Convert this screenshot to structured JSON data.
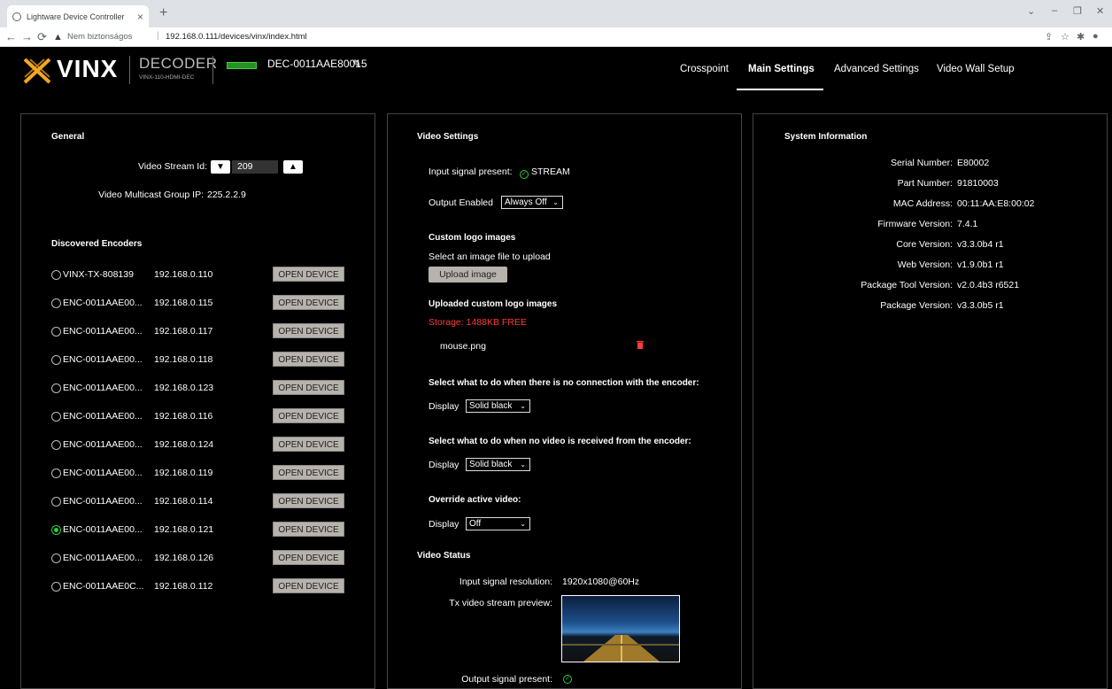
{
  "browser": {
    "tab_title": "Lightware Device Controller",
    "security_label": "Nem biztonságos",
    "url": "192.168.0.111/devices/vinx/index.html"
  },
  "header": {
    "logo": "VINX",
    "product_type": "DECODER",
    "product_model": "VINX-110-HDMI-DEC",
    "badge": "MULTICAST",
    "device_name": "DEC-0011AAE80015",
    "nav": [
      "Crosspoint",
      "Main Settings",
      "Advanced Settings",
      "Video Wall Setup"
    ],
    "active_nav": "Main Settings"
  },
  "general": {
    "title": "General",
    "stream_id_label": "Video Stream Id:",
    "stream_id": "209",
    "multicast_label": "Video Multicast Group IP:",
    "multicast_ip": "225.2.2.9",
    "encoders_title": "Discovered Encoders",
    "open_label": "OPEN DEVICE",
    "encoders": [
      {
        "name": "VINX-TX-808139",
        "ip": "192.168.0.110",
        "selected": false
      },
      {
        "name": "ENC-0011AAE00...",
        "ip": "192.168.0.115",
        "selected": false
      },
      {
        "name": "ENC-0011AAE00...",
        "ip": "192.168.0.117",
        "selected": false
      },
      {
        "name": "ENC-0011AAE00...",
        "ip": "192.168.0.118",
        "selected": false
      },
      {
        "name": "ENC-0011AAE00...",
        "ip": "192.168.0.123",
        "selected": false
      },
      {
        "name": "ENC-0011AAE00...",
        "ip": "192.168.0.116",
        "selected": false
      },
      {
        "name": "ENC-0011AAE00...",
        "ip": "192.168.0.124",
        "selected": false
      },
      {
        "name": "ENC-0011AAE00...",
        "ip": "192.168.0.119",
        "selected": false
      },
      {
        "name": "ENC-0011AAE00...",
        "ip": "192.168.0.114",
        "selected": false
      },
      {
        "name": "ENC-0011AAE00...",
        "ip": "192.168.0.121",
        "selected": true
      },
      {
        "name": "ENC-0011AAE00...",
        "ip": "192.168.0.126",
        "selected": false
      },
      {
        "name": "ENC-0011AAE0C...",
        "ip": "192.168.0.112",
        "selected": false
      }
    ]
  },
  "video": {
    "title": "Video Settings",
    "input_signal_label": "Input signal present:",
    "input_signal_value": "STREAM",
    "output_enabled_label": "Output Enabled",
    "output_enabled_value": "Always Off",
    "custom_logo_title": "Custom logo images",
    "select_file_label": "Select an image file to upload",
    "upload_label": "Upload image",
    "uploaded_title": "Uploaded custom logo images",
    "storage": "Storage: 1488KB FREE",
    "file_name": "mouse.png",
    "no_conn_title": "Select what to do when there is no connection with the encoder:",
    "display_label": "Display",
    "no_conn_value": "Solid black",
    "no_video_title": "Select what to do when no video is received from the encoder:",
    "no_video_value": "Solid black",
    "override_title": "Override active video:",
    "override_value": "Off",
    "status_title": "Video Status",
    "resolution_label": "Input signal resolution:",
    "resolution_value": "1920x1080@60Hz",
    "preview_label": "Tx video stream preview:",
    "output_signal_label": "Output signal present:"
  },
  "system": {
    "title": "System Information",
    "rows": [
      {
        "label": "Serial Number:",
        "value": "E80002"
      },
      {
        "label": "Part Number:",
        "value": "91810003"
      },
      {
        "label": "MAC Address:",
        "value": "00:11:AA:E8:00:02"
      },
      {
        "label": "Firmware Version:",
        "value": "7.4.1"
      },
      {
        "label": "Core Version:",
        "value": "v3.3.0b4 r1"
      },
      {
        "label": "Web Version:",
        "value": "v1.9.0b1 r1"
      },
      {
        "label": "Package Tool Version:",
        "value": "v2.0.4b3 r6521"
      },
      {
        "label": "Package Version:",
        "value": "v3.3.0b5 r1"
      }
    ]
  }
}
